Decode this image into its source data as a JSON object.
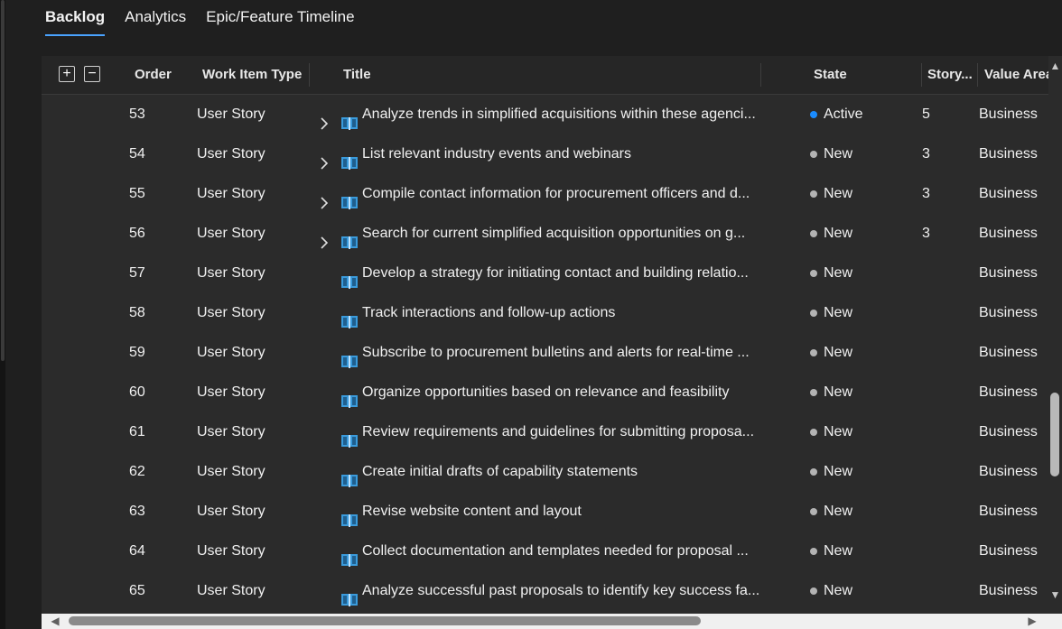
{
  "tabs": [
    {
      "label": "Backlog",
      "selected": true
    },
    {
      "label": "Analytics",
      "selected": false
    },
    {
      "label": "Epic/Feature Timeline",
      "selected": false
    }
  ],
  "grid": {
    "expand_all": "+",
    "collapse_all": "−",
    "columns": {
      "order": "Order",
      "work_item_type": "Work Item Type",
      "title": "Title",
      "state": "State",
      "story_points": "Story...",
      "value_area": "Value Area"
    },
    "colors": {
      "active": "#1a8cff",
      "new": "#b3b3b3",
      "book_icon": "#3a9bdc"
    },
    "rows": [
      {
        "order": "53",
        "type": "User Story",
        "has_children": true,
        "title": "Analyze trends in simplified acquisitions within these agenci...",
        "state": "Active",
        "points": "5",
        "value_area": "Business"
      },
      {
        "order": "54",
        "type": "User Story",
        "has_children": true,
        "title": "List relevant industry events and webinars",
        "state": "New",
        "points": "3",
        "value_area": "Business"
      },
      {
        "order": "55",
        "type": "User Story",
        "has_children": true,
        "title": "Compile contact information for procurement officers and d...",
        "state": "New",
        "points": "3",
        "value_area": "Business"
      },
      {
        "order": "56",
        "type": "User Story",
        "has_children": true,
        "title": "Search for current simplified acquisition opportunities on g...",
        "state": "New",
        "points": "3",
        "value_area": "Business"
      },
      {
        "order": "57",
        "type": "User Story",
        "has_children": false,
        "title": "Develop a strategy for initiating contact and building relatio...",
        "state": "New",
        "points": "",
        "value_area": "Business"
      },
      {
        "order": "58",
        "type": "User Story",
        "has_children": false,
        "title": "Track interactions and follow-up actions",
        "state": "New",
        "points": "",
        "value_area": "Business"
      },
      {
        "order": "59",
        "type": "User Story",
        "has_children": false,
        "title": "Subscribe to procurement bulletins and alerts for real-time ...",
        "state": "New",
        "points": "",
        "value_area": "Business"
      },
      {
        "order": "60",
        "type": "User Story",
        "has_children": false,
        "title": "Organize opportunities based on relevance and feasibility",
        "state": "New",
        "points": "",
        "value_area": "Business"
      },
      {
        "order": "61",
        "type": "User Story",
        "has_children": false,
        "title": "Review requirements and guidelines for submitting proposa...",
        "state": "New",
        "points": "",
        "value_area": "Business"
      },
      {
        "order": "62",
        "type": "User Story",
        "has_children": false,
        "title": "Create initial drafts of capability statements",
        "state": "New",
        "points": "",
        "value_area": "Business"
      },
      {
        "order": "63",
        "type": "User Story",
        "has_children": false,
        "title": "Revise website content and layout",
        "state": "New",
        "points": "",
        "value_area": "Business"
      },
      {
        "order": "64",
        "type": "User Story",
        "has_children": false,
        "title": "Collect documentation and templates needed for proposal ...",
        "state": "New",
        "points": "",
        "value_area": "Business"
      },
      {
        "order": "65",
        "type": "User Story",
        "has_children": false,
        "title": "Analyze successful past proposals to identify key success fa...",
        "state": "New",
        "points": "",
        "value_area": "Business"
      }
    ]
  }
}
